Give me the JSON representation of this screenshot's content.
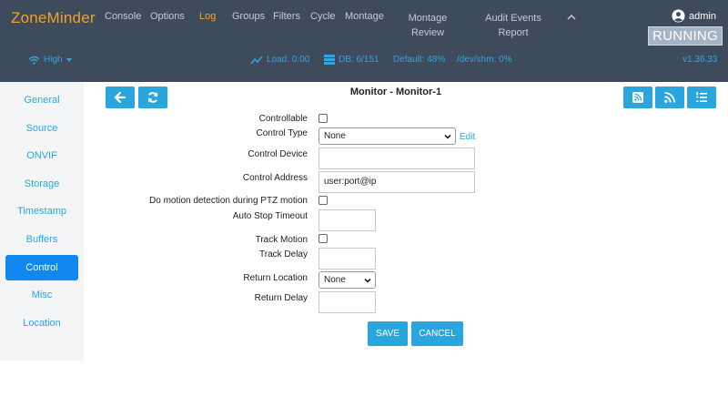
{
  "header": {
    "brand": "ZoneMinder",
    "nav": {
      "console": "Console",
      "options": "Options",
      "log": "Log",
      "groups": "Groups",
      "filters": "Filters",
      "cycle": "Cycle",
      "montage": "Montage",
      "montage_review_line1": "Montage",
      "montage_review_line2": "Review",
      "audit_line1": "Audit Events",
      "audit_line2": "Report"
    },
    "user": "admin",
    "state": "RUNNING",
    "bandwidth": "High",
    "status": {
      "load": "Load: 0.00",
      "db": "DB: 6/151",
      "storage": "Default: 48%",
      "shm": "/dev/shm: 0%"
    },
    "version": "v1.36.33"
  },
  "sidebar": {
    "items": [
      {
        "label": "General"
      },
      {
        "label": "Source"
      },
      {
        "label": "ONVIF"
      },
      {
        "label": "Storage"
      },
      {
        "label": "Timestamp"
      },
      {
        "label": "Buffers"
      },
      {
        "label": "Control"
      },
      {
        "label": "Misc"
      },
      {
        "label": "Location"
      }
    ],
    "active": "Control"
  },
  "page": {
    "title": "Monitor - Monitor-1"
  },
  "form": {
    "controllable": {
      "label": "Controllable",
      "checked": false
    },
    "control_type": {
      "label": "Control Type",
      "value": "None",
      "edit": "Edit"
    },
    "control_device": {
      "label": "Control Device",
      "value": ""
    },
    "control_address": {
      "label": "Control Address",
      "value": "user:port@ip"
    },
    "motion_during_ptz": {
      "label": "Do motion detection during PTZ motion",
      "checked": false
    },
    "auto_stop_timeout": {
      "label": "Auto Stop Timeout",
      "value": ""
    },
    "track_motion": {
      "label": "Track Motion",
      "checked": false
    },
    "track_delay": {
      "label": "Track Delay",
      "value": ""
    },
    "return_location": {
      "label": "Return Location",
      "value": "None"
    },
    "return_delay": {
      "label": "Return Delay",
      "value": ""
    }
  },
  "actions": {
    "save": "SAVE",
    "cancel": "CANCEL"
  },
  "colors": {
    "header_bg": "#3d4b5c",
    "brand": "#f0a030",
    "accent": "#2aa6de",
    "active_tab": "#1188f0"
  }
}
